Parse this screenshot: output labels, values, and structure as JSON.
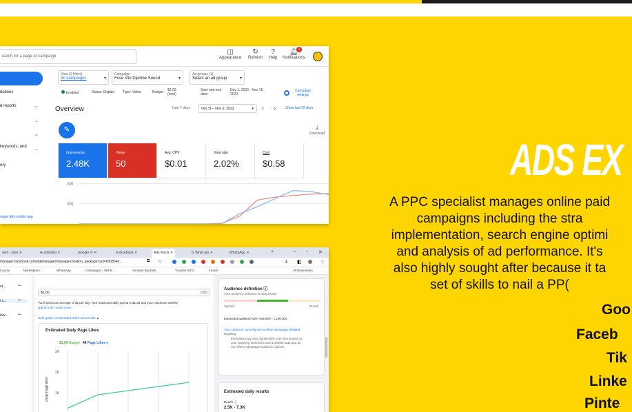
{
  "google_ads": {
    "search_placeholder": "earch for a page or campaign",
    "toolbar": [
      {
        "label": "Appearance",
        "icon": "appearance-icon"
      },
      {
        "label": "Refresh",
        "icon": "refresh-icon"
      },
      {
        "label": "Help",
        "icon": "help-icon"
      },
      {
        "label": "Notifications",
        "icon": "bell-icon"
      }
    ],
    "notif_count": "1",
    "sidebar": [
      {
        "label": "dations",
        "chev": false
      },
      {
        "label": "d reports",
        "chev": true
      },
      {
        "label": "",
        "chev": true
      },
      {
        "label": "",
        "chev": true
      },
      {
        "label": "keywords, and",
        "chev": true
      },
      {
        "label": "ory",
        "chev": false
      }
    ],
    "sidebar_link": "oogle Ads mobile app",
    "view_filter": {
      "label": "View (2 filters)",
      "value": "All campaigns"
    },
    "campaign_filter": {
      "label": "Campaign",
      "value": "Fuse into Djembe Sound"
    },
    "adgroup_filter": {
      "label": "Ad groups (1)",
      "value": "Select an ad group"
    },
    "meta": {
      "status": "Enabled",
      "status_text": "Status: Eligible",
      "type": "Type: Video",
      "budget_label": "Budget",
      "budget": "$2.00",
      "budget_sub": "(total)",
      "dates_label": "Start and end",
      "dates_label2": "date:",
      "dates": "Nov 1, 2023 - Nov 15,",
      "dates2": "2023",
      "settings1": "Campaign",
      "settings2": "settings"
    },
    "overview_title": "Overview",
    "range_label": "Last 7 days",
    "range_value": "Oct 31 – Nov 6, 2023",
    "show30": "Show last 30 days",
    "download": "Download",
    "cards": [
      {
        "label": "Impressions",
        "value": "2.48K",
        "bg": "#1a73e8",
        "fg": "#ffffff"
      },
      {
        "label": "Views",
        "value": "50",
        "bg": "#d93025",
        "fg": "#ffffff"
      },
      {
        "label": "Avg. CPV",
        "value": "$0.01",
        "bg": "#ffffff",
        "fg": "#202124"
      },
      {
        "label": "View rate",
        "value": "2.02%",
        "bg": "#ffffff",
        "fg": "#202124"
      },
      {
        "label": "Cost",
        "value": "$0.58",
        "bg": "#ffffff",
        "fg": "#202124"
      }
    ],
    "chart_y_ticks": [
      "800",
      "400"
    ]
  },
  "facebook_ads": {
    "tabs": [
      {
        "label": "sem - Goo",
        "active": false
      },
      {
        "label": "G advertisi",
        "active": false
      },
      {
        "label": "Google Tr",
        "active": false
      },
      {
        "label": "G facebook",
        "active": false
      },
      {
        "label": "Ads Mana",
        "active": true
      },
      {
        "label": "G What are",
        "active": false
      },
      {
        "label": "WhatsApp",
        "active": false
      }
    ],
    "url": "manager.facebook.com/adsmanager/manage/creation_package?act=6308540...",
    "bookmarks": [
      "Course",
      "Marketplace",
      "WhatsApp",
      "Campaigns - 384-6...",
      "Youtube Backlink",
      "Youtube SEO",
      "Fuseln"
    ],
    "all_bookmarks": "All Bookmarks",
    "sidebar": [
      "et ...",
      "t s...",
      "lew..."
    ],
    "budget_value": "$1.00",
    "currency": "USD",
    "spend_text1": "You'll spend an average of $1 per day. Your maximum daily spend is $1.25 and your maximum weekly",
    "spend_text2": "spend is $7. Learn more",
    "hide_graph": "Hide graph of estimated reach and results ▲",
    "est_title": "Estimated Daily Page Likes",
    "est_budget_value": "$1.00",
    "est_budget_label": "Budget",
    "est_likes_value": "44",
    "est_likes_label": "Page Likes ▾",
    "y_axis_label": "Daily Page likes",
    "y_ticks": [
      "3K",
      "2K",
      "1K"
    ],
    "audience_title": "Audience definition",
    "audience_sub": "Your audience selection is fairly broad.",
    "specific": "Specific",
    "broad": "Broad",
    "aud_size": "Estimated audience size: 945,400 - 1,100,000",
    "criteria1": "Your criteria is currently set to allow Advantage detailed",
    "criteria2": "targeting.",
    "criteria3": "Estimates may vary significantly over time based on",
    "criteria4": "your targeting selections and available data and do",
    "criteria5": "not reflect Advantage audience options.",
    "daily_title": "Estimated daily results",
    "reach_label": "Reach",
    "reach_value": "2.5K - 7.3K"
  },
  "right": {
    "title": "ADS EX",
    "desc": [
      "A PPC specialist manages online paid",
      "campaigns including the stra",
      "implementation, search engine optimi",
      "and analysis of ad performance. It's",
      "also highly sought after because it ta",
      "set of skills to nail a PP("
    ],
    "platforms": [
      "Goo",
      "Faceb",
      "Tik",
      "Linke",
      "Pinte"
    ]
  },
  "chart_data": [
    {
      "type": "line",
      "title": "",
      "y_ticks": [
        "800",
        "400"
      ],
      "series": [
        {
          "values": [
            0,
            0,
            0,
            0,
            0,
            0,
            0,
            0,
            10,
            150,
            470,
            530,
            560,
            590,
            600
          ]
        },
        {
          "values": [
            0,
            0,
            0,
            0,
            0,
            0,
            0,
            0,
            0,
            200,
            340,
            500,
            660,
            640,
            580
          ]
        }
      ]
    },
    {
      "type": "line",
      "title": "Estimated Daily Page Likes",
      "ylabel": "Daily Page likes",
      "y_ticks": [
        "3K",
        "2K",
        "1K"
      ],
      "series": [
        {
          "values": [
            250,
            900,
            1100,
            1300,
            1500
          ]
        }
      ]
    }
  ]
}
